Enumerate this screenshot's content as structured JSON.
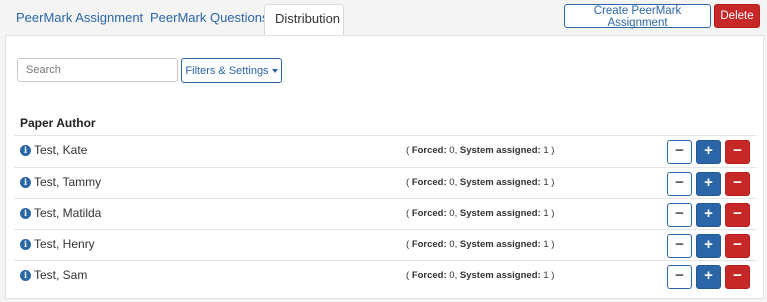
{
  "tabs": [
    {
      "label": "PeerMark Assignment"
    },
    {
      "label": "PeerMark Questions"
    },
    {
      "label": "Distribution"
    }
  ],
  "header_actions": {
    "create_label": "Create PeerMark Assignment",
    "delete_label": "Delete"
  },
  "toolbar": {
    "search_placeholder": "Search",
    "filters_label": "Filters & Settings"
  },
  "table": {
    "column_header": "Paper Author",
    "forced_label": "Forced:",
    "system_label": "System assigned:",
    "rows": [
      {
        "name": "Test, Kate",
        "forced": "0",
        "system_assigned": "1"
      },
      {
        "name": "Test, Tammy",
        "forced": "0",
        "system_assigned": "1"
      },
      {
        "name": "Test, Matilda",
        "forced": "0",
        "system_assigned": "1"
      },
      {
        "name": "Test, Henry",
        "forced": "0",
        "system_assigned": "1"
      },
      {
        "name": "Test, Sam",
        "forced": "0",
        "system_assigned": "1"
      }
    ]
  },
  "colors": {
    "primary": "#2a66a8",
    "danger": "#c62828"
  }
}
